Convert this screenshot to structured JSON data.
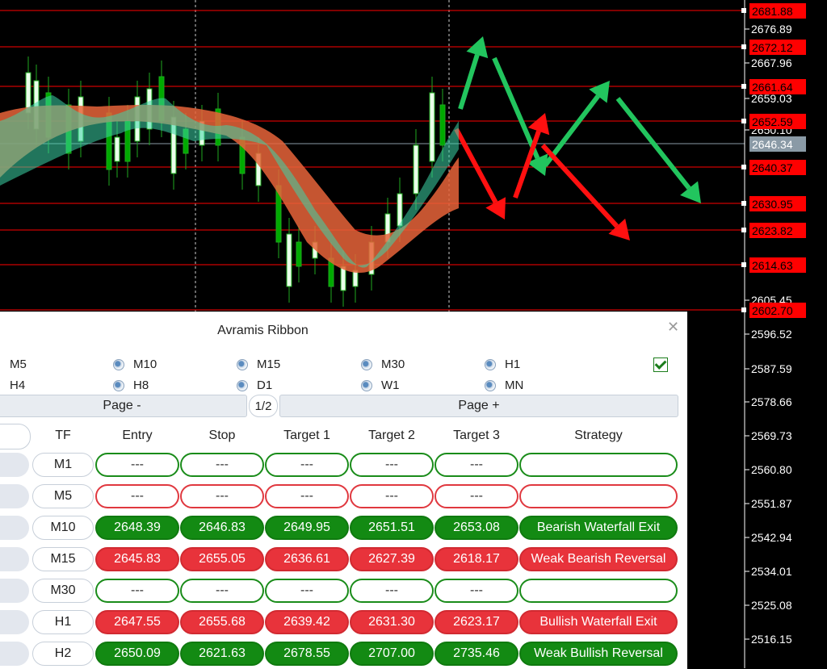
{
  "chart": {
    "price_axis_ticks": [
      "2676.89",
      "2667.96",
      "2659.03",
      "2650.10",
      "2605.45",
      "2596.52",
      "2587.59",
      "2578.66",
      "2569.73",
      "2560.80",
      "2551.87",
      "2542.94",
      "2534.01",
      "2525.08",
      "2516.15"
    ],
    "price_tags_red": [
      "2681.88",
      "2672.12",
      "2661.64",
      "2652.59",
      "2640.37",
      "2630.95",
      "2623.82",
      "2614.63",
      "2602.70"
    ],
    "current_price_tag": "2646.34",
    "colors": {
      "level_line": "#ff0000",
      "bull_arrow": "#22c55e",
      "bear_arrow": "#ff1010",
      "ribbon_bull": "#3dd6a8",
      "ribbon_bear": "#e8643a",
      "candle": "#1fa81f"
    }
  },
  "panel": {
    "title": "Avramis Ribbon",
    "timeframe_options": [
      "M5",
      "M10",
      "M15",
      "M30",
      "H1",
      "H4",
      "H8",
      "D1",
      "W1",
      "MN"
    ],
    "page_prev_label": "Page -",
    "page_indicator": "1/2",
    "page_next_label": "Page +",
    "columns": [
      "TF",
      "Entry",
      "Stop",
      "Target 1",
      "Target 2",
      "Target 3",
      "Strategy"
    ],
    "rows": [
      {
        "tf": "M1",
        "entry": "---",
        "stop": "---",
        "t1": "---",
        "t2": "---",
        "t3": "---",
        "strategy": "",
        "style": "green-outline"
      },
      {
        "tf": "M5",
        "entry": "---",
        "stop": "---",
        "t1": "---",
        "t2": "---",
        "t3": "---",
        "strategy": "",
        "style": "red-outline"
      },
      {
        "tf": "M10",
        "entry": "2648.39",
        "stop": "2646.83",
        "t1": "2649.95",
        "t2": "2651.51",
        "t3": "2653.08",
        "strategy": "Bearish Waterfall Exit",
        "style": "green"
      },
      {
        "tf": "M15",
        "entry": "2645.83",
        "stop": "2655.05",
        "t1": "2636.61",
        "t2": "2627.39",
        "t3": "2618.17",
        "strategy": "Weak Bearish Reversal",
        "style": "red"
      },
      {
        "tf": "M30",
        "entry": "---",
        "stop": "---",
        "t1": "---",
        "t2": "---",
        "t3": "---",
        "strategy": "",
        "style": "green-outline"
      },
      {
        "tf": "H1",
        "entry": "2647.55",
        "stop": "2655.68",
        "t1": "2639.42",
        "t2": "2631.30",
        "t3": "2623.17",
        "strategy": "Bullish Waterfall Exit",
        "style": "red"
      },
      {
        "tf": "H2",
        "entry": "2650.09",
        "stop": "2621.63",
        "t1": "2678.55",
        "t2": "2707.00",
        "t3": "2735.46",
        "strategy": "Weak Bullish Reversal",
        "style": "green"
      }
    ]
  }
}
